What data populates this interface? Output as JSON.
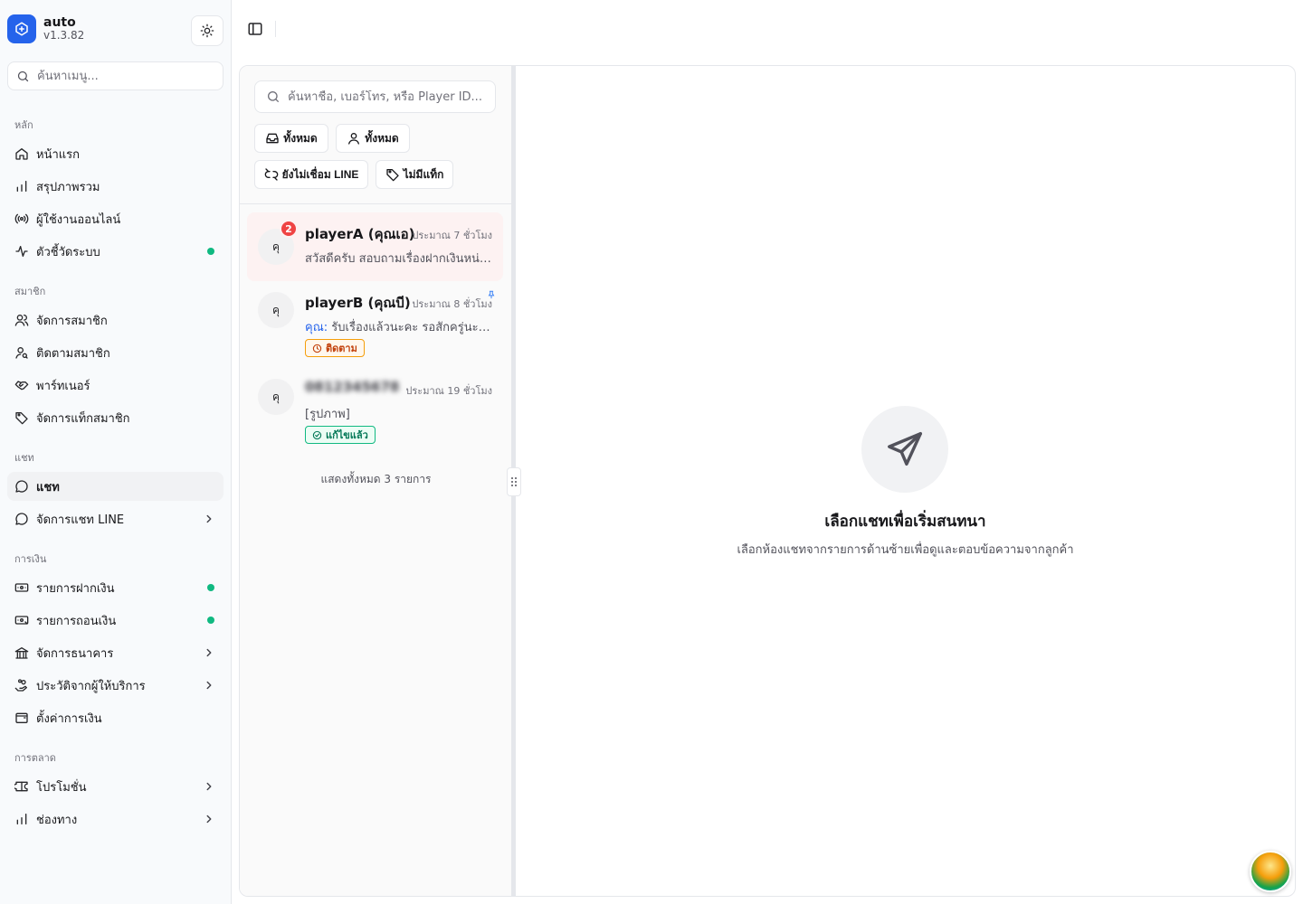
{
  "brand": {
    "name": "auto",
    "version": "v1.3.82"
  },
  "sidebar": {
    "search_placeholder": "ค้นหาเมนู...",
    "groups": [
      {
        "label": "หลัก",
        "items": [
          {
            "label": "หน้าแรก",
            "icon": "home-icon"
          },
          {
            "label": "สรุปภาพรวม",
            "icon": "bar-chart-icon"
          },
          {
            "label": "ผู้ใช้งานออนไลน์",
            "icon": "radio-icon"
          },
          {
            "label": "ตัวชี้วัดระบบ",
            "icon": "activity-icon",
            "status_dot": true
          }
        ]
      },
      {
        "label": "สมาชิก",
        "items": [
          {
            "label": "จัดการสมาชิก",
            "icon": "users-icon"
          },
          {
            "label": "ติดตามสมาชิก",
            "icon": "user-search-icon"
          },
          {
            "label": "พาร์ทเนอร์",
            "icon": "handshake-icon"
          },
          {
            "label": "จัดการแท็กสมาชิก",
            "icon": "tag-icon"
          }
        ]
      },
      {
        "label": "แชท",
        "items": [
          {
            "label": "แชท",
            "icon": "message-circle-icon",
            "active": true
          },
          {
            "label": "จัดการแชท LINE",
            "icon": "message-circle-icon",
            "has_children": true
          }
        ]
      },
      {
        "label": "การเงิน",
        "items": [
          {
            "label": "รายการฝากเงิน",
            "icon": "banknote-in-icon",
            "status_dot": true
          },
          {
            "label": "รายการถอนเงิน",
            "icon": "banknote-out-icon",
            "status_dot": true
          },
          {
            "label": "จัดการธนาคาร",
            "icon": "landmark-icon",
            "has_children": true
          },
          {
            "label": "ประวัติจากผู้ให้บริการ",
            "icon": "hand-coins-icon",
            "has_children": true
          },
          {
            "label": "ตั้งค่าการเงิน",
            "icon": "wallet-icon"
          }
        ]
      },
      {
        "label": "การตลาด",
        "items": [
          {
            "label": "โปรโมชั่น",
            "icon": "ticket-icon",
            "has_children": true
          },
          {
            "label": "ช่องทาง",
            "icon": "bar-chart-icon",
            "has_children": true
          }
        ]
      }
    ]
  },
  "chat_list": {
    "search_placeholder": "ค้นหาชื่อ, เบอร์โทร, หรือ Player ID...",
    "filters": [
      {
        "label": "ทั้งหมด",
        "icon": "inbox-icon"
      },
      {
        "label": "ทั้งหมด",
        "icon": "user-icon"
      },
      {
        "label": "ยังไม่เชื่อม LINE",
        "icon": "unlink-icon"
      },
      {
        "label": "ไม่มีแท็ก",
        "icon": "tag-icon"
      }
    ],
    "conversations": [
      {
        "avatar": "คุ",
        "name": "playerA (คุณเอ)",
        "time": "ประมาณ 7 ชั่วโมง",
        "preview": "สวัสดีครับ สอบถามเรื่องฝากเงินหน่อยครับ",
        "unread": 2
      },
      {
        "avatar": "คุ",
        "name": "playerB (คุณบี)",
        "time": "ประมาณ 8 ชั่วโมง",
        "preview_prefix": "คุณ:",
        "preview": "รับเรื่องแล้วนะคะ รอสักครู่นะคะ",
        "tag": "ติดตาม",
        "pinned": true
      },
      {
        "avatar": "คุ",
        "name": "0812345678",
        "name_blurred": true,
        "time": "ประมาณ 19 ชั่วโมง",
        "preview": "[รูปภาพ]",
        "tag": "แก้ไขแล้ว"
      }
    ],
    "total_text": "แสดงทั้งหมด 3 รายการ"
  },
  "empty_state": {
    "icon": "send-icon",
    "title": "เลือกแชทเพื่อเริ่มสนทนา",
    "subtitle": "เลือกห้องแชทจากรายการด้านซ้ายเพื่อดูและตอบข้อความจากลูกค้า"
  },
  "colors": {
    "accent": "#2563eb",
    "status_green": "#10b981",
    "badge_red": "#ef4444",
    "follow_tag": "#f59e0b"
  }
}
